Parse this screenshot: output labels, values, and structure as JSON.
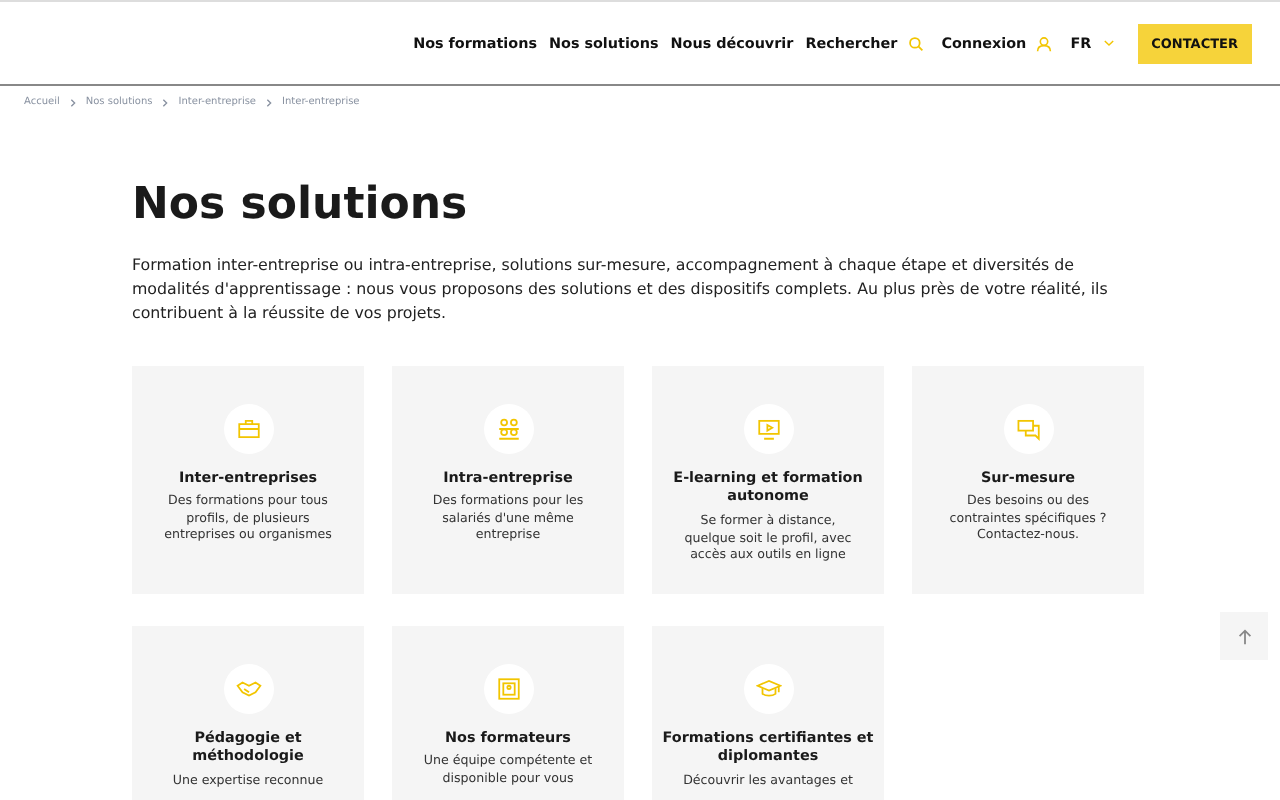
{
  "nav": {
    "links": [
      "Nos formations",
      "Nos solutions",
      "Nous découvrir"
    ],
    "search": "Rechercher",
    "login": "Connexion",
    "language": "FR",
    "contact": "CONTACTER"
  },
  "breadcrumb": [
    "Accueil",
    "Nos solutions",
    "Inter-entreprise",
    "Inter-entreprise"
  ],
  "title": "Nos solutions",
  "intro": "Formation inter-entreprise ou intra-entreprise, solutions sur-mesure, accompagnement à chaque étape et diversités de modalités d'apprentissage : nous vous proposons des solutions et des dispositifs complets. Au plus près de votre réalité, ils contribuent à la réussite de vos projets.",
  "cards": [
    {
      "kind": "briefcase",
      "title": "Inter-entreprises",
      "text": "Des formations pour tous profils, de plusieurs entreprises ou organismes"
    },
    {
      "kind": "people",
      "title": "Intra-entreprise",
      "text": "Des formations pour les salariés d'une même entreprise"
    },
    {
      "kind": "screen",
      "title": "E-learning et formation autonome",
      "text": "Se former à distance, quelque soit le profil, avec accès aux outils en ligne"
    },
    {
      "kind": "chat",
      "title": "Sur-mesure",
      "text": "Des besoins ou des contraintes spécifiques ? Contactez-nous."
    },
    {
      "kind": "handshake",
      "title": "Pédagogie et méthodologie",
      "text": "Une expertise reconnue"
    },
    {
      "kind": "board",
      "title": "Nos formateurs",
      "text": "Une équipe compétente et disponible pour vous"
    },
    {
      "kind": "cap",
      "title": "Formations certifiantes et diplomantes",
      "text": "Découvrir les avantages et"
    }
  ]
}
